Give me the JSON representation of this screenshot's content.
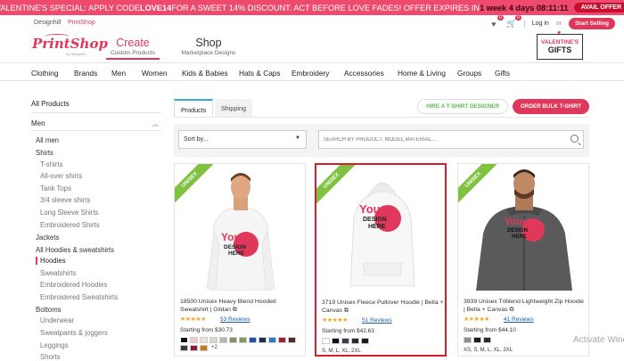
{
  "promo": {
    "text_a": "VALENTINE'S SPECIAL: APPLY CODE ",
    "code": "LOVE14",
    "text_b": " FOR A SWEET 14% DISCOUNT. ACT BEFORE LOVE FADES! OFFER EXPIRES IN ",
    "countdown": "1 week 4 days 08:11:11",
    "button": "AVAIL OFFER",
    "bg_color": "#ee4a6e"
  },
  "topbar": {
    "tabs": [
      "Designhill",
      "PrintShop"
    ],
    "heart_count": "0",
    "cart_count": "0",
    "login": "Log in",
    "or": "or",
    "start_selling": "Start Selling"
  },
  "header": {
    "logo_text": "PrintShop",
    "logo_sub": "by designhill",
    "create_title": "Create",
    "create_sub": "Custom Products",
    "shop_title": "Shop",
    "shop_sub": "Marketplace Designs",
    "valentine_line1": "VALENTINE'S",
    "valentine_line2": "GIFTS",
    "accent": "#e0385b"
  },
  "categories": [
    "Clothing",
    "Brands",
    "Men",
    "Women",
    "Kids & Babies",
    "Hats & Caps",
    "Embroidery",
    "Accessories",
    "Home & Living",
    "Groups",
    "Gifts"
  ],
  "sidebar": {
    "all_products": "All Products",
    "men": "Men",
    "items": [
      "All men",
      "Shirts",
      "T-shirts",
      "All-over shirts",
      "Tank Tops",
      "3/4 sleeve shirts",
      "Long Sleeve Shirts",
      "Embroidered Shirts",
      "Jackets",
      "All Hoodies & sweatshirts",
      "Hoodies",
      "Sweatshirts",
      "Embroidered Hoodies",
      "Embroidered Sweatshirts",
      "Bottoms",
      "Underwear",
      "Sweatpants & joggers",
      "Leggings",
      "Shorts"
    ]
  },
  "tabs": {
    "products": "Products",
    "shipping": "Shipping",
    "designer_button": "HIRE A T-SHIRT DESIGNER",
    "bulk_button": "ORDER BULK T-SHIRT"
  },
  "filters": {
    "sort_label": "Sort by...",
    "search_placeholder": "SEARCH BY PRODUCT, MODEL,MATERIAL..."
  },
  "products": [
    {
      "ribbon": "UNISEX",
      "name": "18500 Unisex Heavy Blend Hooded Sweatshirt | Gildan ⧉",
      "stars": "★★★★★",
      "reviews": "53 Reviews",
      "price": "Starting from $30.73",
      "swatches": [
        "#111111",
        "#f4c6d3",
        "#e8e2d6",
        "#d7d7d2",
        "#b7b7a9",
        "#8a8b6e",
        "#7d9a5e",
        "#1f4ea8",
        "#1b2b5a",
        "#2b7bbf",
        "#a12030",
        "#4a2b26",
        "#3a3a3a",
        "#8f1c2c",
        "#c47a1c"
      ],
      "sizes": "",
      "more": "+2"
    },
    {
      "ribbon": "UNISEX",
      "name": "3719 Unisex Fleece Pullover Hoodie | Bella + Canvas ⧉",
      "stars": "★★★★★",
      "reviews": "51 Reviews",
      "price": "Starting from $42.63",
      "swatches": [
        "#ffffff",
        "#111111",
        "#3a3f4a",
        "#2a2a2a",
        "#1a1a1a"
      ],
      "sizes": "S, M, L, XL, 2XL",
      "more": ""
    },
    {
      "ribbon": "UNISEX",
      "name": "3939 Unisex Triblend Lightweight Zip Hoodie | Bella + Canvas ⧉",
      "stars": "★★★★★",
      "reviews": "41 Reviews",
      "price": "Starting from $44.10",
      "swatches": [
        "#8d8d8d",
        "#1a1a1a",
        "#2c2c2c"
      ],
      "sizes": "XS, S, M, L, XL, 2XL",
      "more": ""
    }
  ],
  "design_text": [
    "Your",
    "DESIGN",
    "HERE"
  ],
  "watermark": "Activate Windows"
}
